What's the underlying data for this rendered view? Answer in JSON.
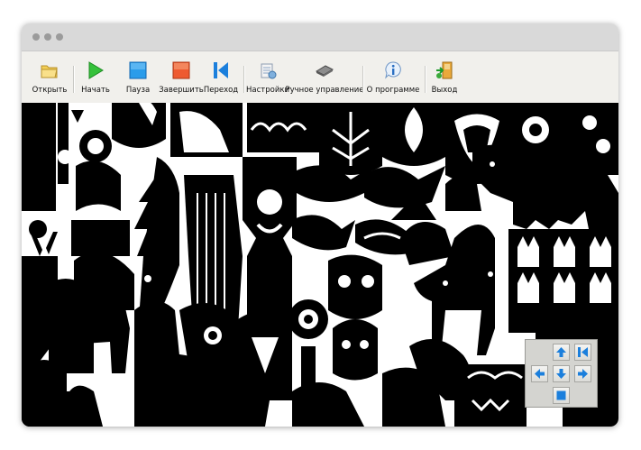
{
  "toolbar": {
    "open": "Открыть",
    "start": "Начать",
    "pause": "Пауза",
    "finish": "Завершить",
    "jump": "Переход",
    "settings": "Настройки",
    "manual": "Ручное управление",
    "about": "О программе",
    "exit": "Выход"
  },
  "icons": {
    "open": "folder-icon",
    "start": "play-icon",
    "pause": "pause-square-icon",
    "finish": "stop-square-icon",
    "jump": "skip-to-start-icon",
    "settings": "settings-icon",
    "manual": "chip-icon",
    "about": "info-icon",
    "exit": "exit-door-icon"
  },
  "nav_pad": {
    "buttons": [
      "up",
      "skip-to-start",
      "left",
      "down",
      "right",
      "stop"
    ]
  },
  "colors": {
    "titlebar": "#d9d9d9",
    "toolbar": "#f1f0ec",
    "artwork": "#000000",
    "play": "#2fb52f",
    "pause": "#1c8fe0",
    "stop": "#e8502a",
    "nav_arrow": "#1b7fdc"
  }
}
